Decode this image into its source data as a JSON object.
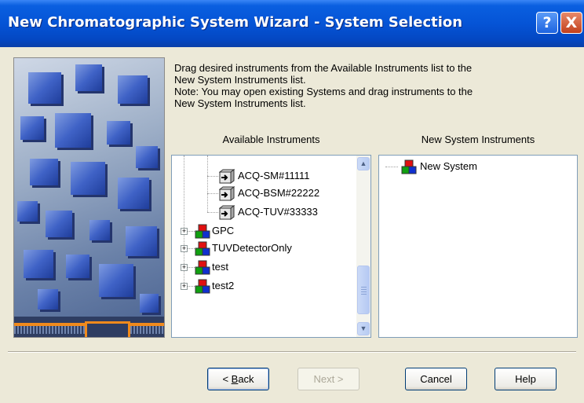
{
  "window": {
    "title": "New Chromatographic System Wizard - System Selection",
    "help_glyph": "?",
    "close_glyph": "X"
  },
  "instructions": {
    "line1": "Drag desired instruments from the Available Instruments list to the",
    "line2": "New System Instruments list.",
    "line3": "Note:  You may open existing Systems and drag instruments to the",
    "line4": "New System Instruments list."
  },
  "available": {
    "label": "Available Instruments",
    "items": [
      {
        "label": "ACQ-SM#11111",
        "type": "instrument"
      },
      {
        "label": "ACQ-BSM#22222",
        "type": "instrument"
      },
      {
        "label": "ACQ-TUV#33333",
        "type": "instrument"
      },
      {
        "label": "GPC",
        "type": "system",
        "expander": "+"
      },
      {
        "label": "TUVDetectorOnly",
        "type": "system",
        "expander": "+"
      },
      {
        "label": "test",
        "type": "system",
        "expander": "+"
      },
      {
        "label": "test2",
        "type": "system",
        "expander": "+"
      }
    ],
    "scroll_up": "▲",
    "scroll_down": "▼"
  },
  "new_system": {
    "label": "New System Instruments",
    "items": [
      {
        "label": "New System",
        "type": "system"
      }
    ]
  },
  "buttons": {
    "back_underline": "B",
    "back_rest": "ack",
    "back_prefix": "< ",
    "next": "Next >",
    "cancel": "Cancel",
    "help": "Help"
  },
  "colors": {
    "title_bar": "#0554d6",
    "dialog_bg": "#ece9d8",
    "accent_orange": "#f08a1c"
  }
}
